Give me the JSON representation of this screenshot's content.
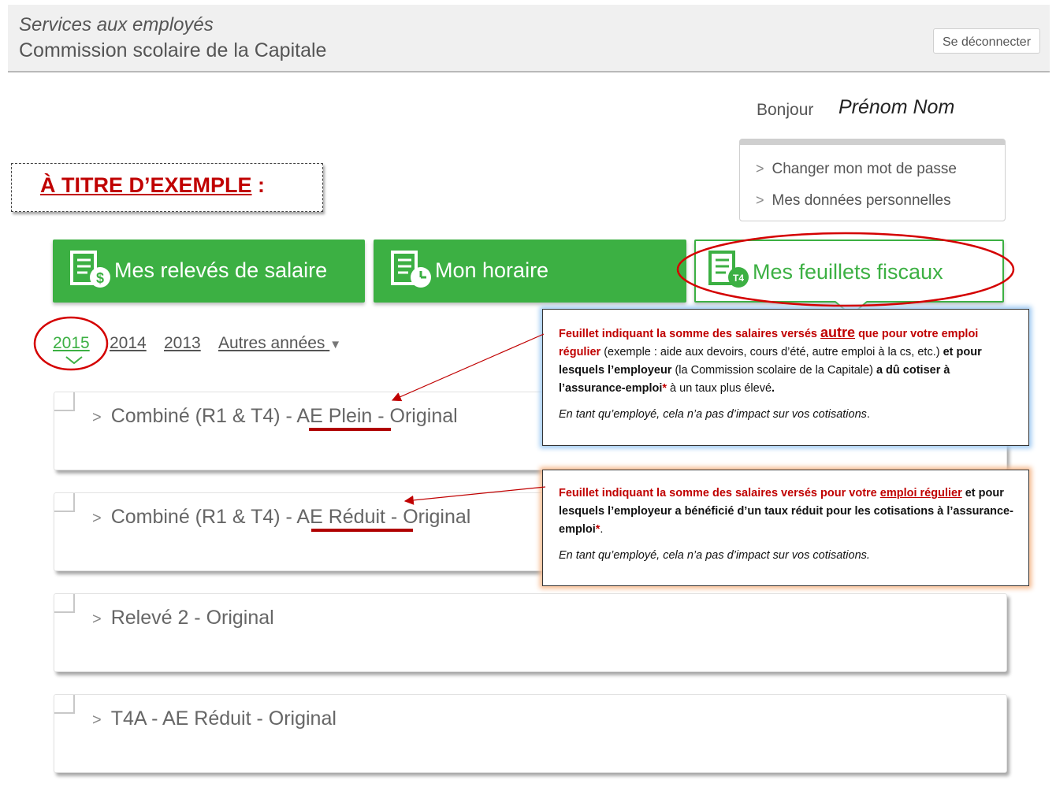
{
  "header": {
    "app_title": "Services aux employés",
    "org_name": "Commission scolaire de la Capitale",
    "logout_label": "Se déconnecter"
  },
  "user": {
    "greeting": "Bonjour",
    "name": "Prénom Nom"
  },
  "account_menu": {
    "items": [
      "Changer mon mot de passe",
      "Mes données personnelles"
    ]
  },
  "example_label": {
    "text": "À TITRE D’EXEMPLE",
    "suffix": " :"
  },
  "tabs": [
    {
      "label": "Mes relevés de salaire",
      "icon": "salary-document-icon",
      "active": false
    },
    {
      "label": "Mon horaire",
      "icon": "schedule-document-icon",
      "active": false
    },
    {
      "label": "Mes feuillets fiscaux",
      "icon": "tax-slip-document-icon",
      "active": true
    }
  ],
  "years": {
    "items": [
      "2015",
      "2014",
      "2013",
      "Autres années"
    ],
    "selected": "2015"
  },
  "documents": [
    {
      "pre": "Combiné (R1 & T4) - ",
      "highlight": "AE Plein",
      "post": " - Original"
    },
    {
      "pre": "Combiné (R1 & T4) - ",
      "highlight": "AE Réduit",
      "post": " - Original"
    },
    {
      "title": "Relevé 2 - Original"
    },
    {
      "title": "T4A - AE Réduit - Original"
    }
  ],
  "callout_plein": {
    "p1_red": "Feuillet indiquant la somme des salaires versés ",
    "p1_big": "autre",
    "p1_red2": " que pour votre emploi régulier",
    "p1_normal": " (exemple : aide aux devoirs, cours d’été, autre emploi à la cs, etc.) ",
    "p1_bold": "et pour lesquels l’employeur",
    "p1_normal2": " (la Commission scolaire de la Capitale) ",
    "p1_bold2": "a dû cotiser à l’assurance-emploi",
    "asterisk": "*",
    "p1_normal3": " à un taux plus élevé",
    "p1_end": ".",
    "note": "En tant qu’employé, cela n’a pas d’impact sur vos cotisations",
    "note_end": "."
  },
  "callout_reduit": {
    "p1_red": "Feuillet indiquant la somme des salaires versés pour votre ",
    "p1_red_u": "emploi régulier",
    "p1_bold": " et pour lesquels l’employeur a bénéficié d’un taux réduit pour les cotisations à l’assurance-emploi",
    "asterisk": "*",
    "p1_end": ".",
    "note": "En tant qu’employé, cela n’a pas d’impact sur vos cotisations."
  },
  "colors": {
    "accent_green": "#3cb043",
    "annotation_red": "#c00000",
    "callout_blue_glow": "#9ec9f2",
    "callout_orange_glow": "#f6b98d"
  }
}
